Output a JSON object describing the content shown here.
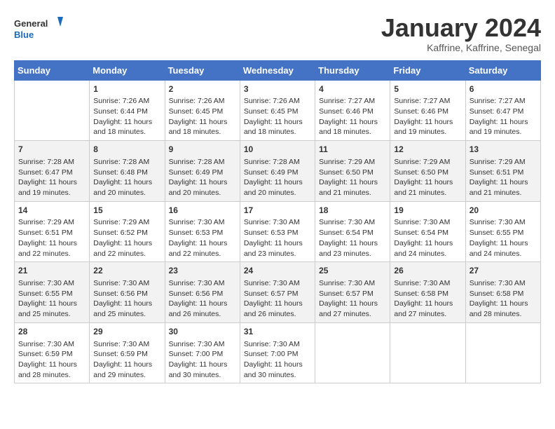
{
  "header": {
    "logo_line1": "General",
    "logo_line2": "Blue",
    "month": "January 2024",
    "location": "Kaffrine, Kaffrine, Senegal"
  },
  "days_of_week": [
    "Sunday",
    "Monday",
    "Tuesday",
    "Wednesday",
    "Thursday",
    "Friday",
    "Saturday"
  ],
  "weeks": [
    [
      {
        "day": "",
        "info": ""
      },
      {
        "day": "1",
        "info": "Sunrise: 7:26 AM\nSunset: 6:44 PM\nDaylight: 11 hours and 18 minutes."
      },
      {
        "day": "2",
        "info": "Sunrise: 7:26 AM\nSunset: 6:45 PM\nDaylight: 11 hours and 18 minutes."
      },
      {
        "day": "3",
        "info": "Sunrise: 7:26 AM\nSunset: 6:45 PM\nDaylight: 11 hours and 18 minutes."
      },
      {
        "day": "4",
        "info": "Sunrise: 7:27 AM\nSunset: 6:46 PM\nDaylight: 11 hours and 18 minutes."
      },
      {
        "day": "5",
        "info": "Sunrise: 7:27 AM\nSunset: 6:46 PM\nDaylight: 11 hours and 19 minutes."
      },
      {
        "day": "6",
        "info": "Sunrise: 7:27 AM\nSunset: 6:47 PM\nDaylight: 11 hours and 19 minutes."
      }
    ],
    [
      {
        "day": "7",
        "info": "Sunrise: 7:28 AM\nSunset: 6:47 PM\nDaylight: 11 hours and 19 minutes."
      },
      {
        "day": "8",
        "info": "Sunrise: 7:28 AM\nSunset: 6:48 PM\nDaylight: 11 hours and 20 minutes."
      },
      {
        "day": "9",
        "info": "Sunrise: 7:28 AM\nSunset: 6:49 PM\nDaylight: 11 hours and 20 minutes."
      },
      {
        "day": "10",
        "info": "Sunrise: 7:28 AM\nSunset: 6:49 PM\nDaylight: 11 hours and 20 minutes."
      },
      {
        "day": "11",
        "info": "Sunrise: 7:29 AM\nSunset: 6:50 PM\nDaylight: 11 hours and 21 minutes."
      },
      {
        "day": "12",
        "info": "Sunrise: 7:29 AM\nSunset: 6:50 PM\nDaylight: 11 hours and 21 minutes."
      },
      {
        "day": "13",
        "info": "Sunrise: 7:29 AM\nSunset: 6:51 PM\nDaylight: 11 hours and 21 minutes."
      }
    ],
    [
      {
        "day": "14",
        "info": "Sunrise: 7:29 AM\nSunset: 6:51 PM\nDaylight: 11 hours and 22 minutes."
      },
      {
        "day": "15",
        "info": "Sunrise: 7:29 AM\nSunset: 6:52 PM\nDaylight: 11 hours and 22 minutes."
      },
      {
        "day": "16",
        "info": "Sunrise: 7:30 AM\nSunset: 6:53 PM\nDaylight: 11 hours and 22 minutes."
      },
      {
        "day": "17",
        "info": "Sunrise: 7:30 AM\nSunset: 6:53 PM\nDaylight: 11 hours and 23 minutes."
      },
      {
        "day": "18",
        "info": "Sunrise: 7:30 AM\nSunset: 6:54 PM\nDaylight: 11 hours and 23 minutes."
      },
      {
        "day": "19",
        "info": "Sunrise: 7:30 AM\nSunset: 6:54 PM\nDaylight: 11 hours and 24 minutes."
      },
      {
        "day": "20",
        "info": "Sunrise: 7:30 AM\nSunset: 6:55 PM\nDaylight: 11 hours and 24 minutes."
      }
    ],
    [
      {
        "day": "21",
        "info": "Sunrise: 7:30 AM\nSunset: 6:55 PM\nDaylight: 11 hours and 25 minutes."
      },
      {
        "day": "22",
        "info": "Sunrise: 7:30 AM\nSunset: 6:56 PM\nDaylight: 11 hours and 25 minutes."
      },
      {
        "day": "23",
        "info": "Sunrise: 7:30 AM\nSunset: 6:56 PM\nDaylight: 11 hours and 26 minutes."
      },
      {
        "day": "24",
        "info": "Sunrise: 7:30 AM\nSunset: 6:57 PM\nDaylight: 11 hours and 26 minutes."
      },
      {
        "day": "25",
        "info": "Sunrise: 7:30 AM\nSunset: 6:57 PM\nDaylight: 11 hours and 27 minutes."
      },
      {
        "day": "26",
        "info": "Sunrise: 7:30 AM\nSunset: 6:58 PM\nDaylight: 11 hours and 27 minutes."
      },
      {
        "day": "27",
        "info": "Sunrise: 7:30 AM\nSunset: 6:58 PM\nDaylight: 11 hours and 28 minutes."
      }
    ],
    [
      {
        "day": "28",
        "info": "Sunrise: 7:30 AM\nSunset: 6:59 PM\nDaylight: 11 hours and 28 minutes."
      },
      {
        "day": "29",
        "info": "Sunrise: 7:30 AM\nSunset: 6:59 PM\nDaylight: 11 hours and 29 minutes."
      },
      {
        "day": "30",
        "info": "Sunrise: 7:30 AM\nSunset: 7:00 PM\nDaylight: 11 hours and 30 minutes."
      },
      {
        "day": "31",
        "info": "Sunrise: 7:30 AM\nSunset: 7:00 PM\nDaylight: 11 hours and 30 minutes."
      },
      {
        "day": "",
        "info": ""
      },
      {
        "day": "",
        "info": ""
      },
      {
        "day": "",
        "info": ""
      }
    ]
  ]
}
